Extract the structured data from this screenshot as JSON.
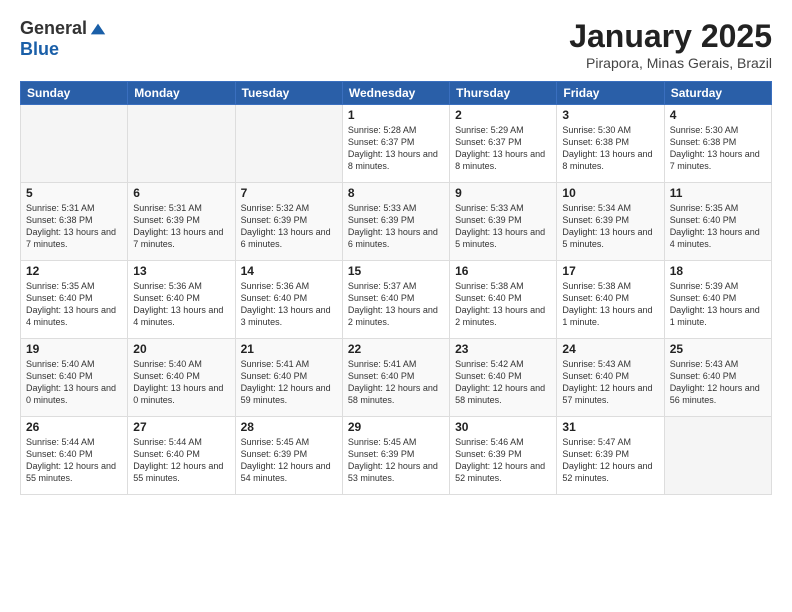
{
  "logo": {
    "general": "General",
    "blue": "Blue"
  },
  "title": "January 2025",
  "subtitle": "Pirapora, Minas Gerais, Brazil",
  "days_of_week": [
    "Sunday",
    "Monday",
    "Tuesday",
    "Wednesday",
    "Thursday",
    "Friday",
    "Saturday"
  ],
  "weeks": [
    [
      {
        "day": "",
        "info": ""
      },
      {
        "day": "",
        "info": ""
      },
      {
        "day": "",
        "info": ""
      },
      {
        "day": "1",
        "info": "Sunrise: 5:28 AM\nSunset: 6:37 PM\nDaylight: 13 hours and 8 minutes."
      },
      {
        "day": "2",
        "info": "Sunrise: 5:29 AM\nSunset: 6:37 PM\nDaylight: 13 hours and 8 minutes."
      },
      {
        "day": "3",
        "info": "Sunrise: 5:30 AM\nSunset: 6:38 PM\nDaylight: 13 hours and 8 minutes."
      },
      {
        "day": "4",
        "info": "Sunrise: 5:30 AM\nSunset: 6:38 PM\nDaylight: 13 hours and 7 minutes."
      }
    ],
    [
      {
        "day": "5",
        "info": "Sunrise: 5:31 AM\nSunset: 6:38 PM\nDaylight: 13 hours and 7 minutes."
      },
      {
        "day": "6",
        "info": "Sunrise: 5:31 AM\nSunset: 6:39 PM\nDaylight: 13 hours and 7 minutes."
      },
      {
        "day": "7",
        "info": "Sunrise: 5:32 AM\nSunset: 6:39 PM\nDaylight: 13 hours and 6 minutes."
      },
      {
        "day": "8",
        "info": "Sunrise: 5:33 AM\nSunset: 6:39 PM\nDaylight: 13 hours and 6 minutes."
      },
      {
        "day": "9",
        "info": "Sunrise: 5:33 AM\nSunset: 6:39 PM\nDaylight: 13 hours and 5 minutes."
      },
      {
        "day": "10",
        "info": "Sunrise: 5:34 AM\nSunset: 6:39 PM\nDaylight: 13 hours and 5 minutes."
      },
      {
        "day": "11",
        "info": "Sunrise: 5:35 AM\nSunset: 6:40 PM\nDaylight: 13 hours and 4 minutes."
      }
    ],
    [
      {
        "day": "12",
        "info": "Sunrise: 5:35 AM\nSunset: 6:40 PM\nDaylight: 13 hours and 4 minutes."
      },
      {
        "day": "13",
        "info": "Sunrise: 5:36 AM\nSunset: 6:40 PM\nDaylight: 13 hours and 4 minutes."
      },
      {
        "day": "14",
        "info": "Sunrise: 5:36 AM\nSunset: 6:40 PM\nDaylight: 13 hours and 3 minutes."
      },
      {
        "day": "15",
        "info": "Sunrise: 5:37 AM\nSunset: 6:40 PM\nDaylight: 13 hours and 2 minutes."
      },
      {
        "day": "16",
        "info": "Sunrise: 5:38 AM\nSunset: 6:40 PM\nDaylight: 13 hours and 2 minutes."
      },
      {
        "day": "17",
        "info": "Sunrise: 5:38 AM\nSunset: 6:40 PM\nDaylight: 13 hours and 1 minute."
      },
      {
        "day": "18",
        "info": "Sunrise: 5:39 AM\nSunset: 6:40 PM\nDaylight: 13 hours and 1 minute."
      }
    ],
    [
      {
        "day": "19",
        "info": "Sunrise: 5:40 AM\nSunset: 6:40 PM\nDaylight: 13 hours and 0 minutes."
      },
      {
        "day": "20",
        "info": "Sunrise: 5:40 AM\nSunset: 6:40 PM\nDaylight: 13 hours and 0 minutes."
      },
      {
        "day": "21",
        "info": "Sunrise: 5:41 AM\nSunset: 6:40 PM\nDaylight: 12 hours and 59 minutes."
      },
      {
        "day": "22",
        "info": "Sunrise: 5:41 AM\nSunset: 6:40 PM\nDaylight: 12 hours and 58 minutes."
      },
      {
        "day": "23",
        "info": "Sunrise: 5:42 AM\nSunset: 6:40 PM\nDaylight: 12 hours and 58 minutes."
      },
      {
        "day": "24",
        "info": "Sunrise: 5:43 AM\nSunset: 6:40 PM\nDaylight: 12 hours and 57 minutes."
      },
      {
        "day": "25",
        "info": "Sunrise: 5:43 AM\nSunset: 6:40 PM\nDaylight: 12 hours and 56 minutes."
      }
    ],
    [
      {
        "day": "26",
        "info": "Sunrise: 5:44 AM\nSunset: 6:40 PM\nDaylight: 12 hours and 55 minutes."
      },
      {
        "day": "27",
        "info": "Sunrise: 5:44 AM\nSunset: 6:40 PM\nDaylight: 12 hours and 55 minutes."
      },
      {
        "day": "28",
        "info": "Sunrise: 5:45 AM\nSunset: 6:39 PM\nDaylight: 12 hours and 54 minutes."
      },
      {
        "day": "29",
        "info": "Sunrise: 5:45 AM\nSunset: 6:39 PM\nDaylight: 12 hours and 53 minutes."
      },
      {
        "day": "30",
        "info": "Sunrise: 5:46 AM\nSunset: 6:39 PM\nDaylight: 12 hours and 52 minutes."
      },
      {
        "day": "31",
        "info": "Sunrise: 5:47 AM\nSunset: 6:39 PM\nDaylight: 12 hours and 52 minutes."
      },
      {
        "day": "",
        "info": ""
      }
    ]
  ]
}
